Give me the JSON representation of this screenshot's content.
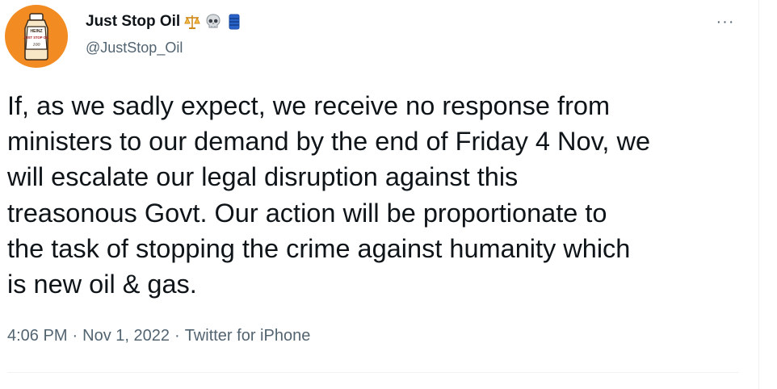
{
  "tweet": {
    "avatar": {
      "alt": "Just Stop Oil logo",
      "label_top": "HEINZ",
      "label_mid": "JUST STOP OIL",
      "label_num": "100",
      "color": "#f28c22"
    },
    "display_name": "Just Stop Oil",
    "name_emojis": [
      "balance-scale-icon",
      "skull-icon",
      "oil-barrel-icon"
    ],
    "handle": "@JustStop_Oil",
    "more_label": "···",
    "text": "If, as we sadly expect, we receive no response from\nministers to our demand by the end of Friday 4 Nov, we\nwill escalate our legal disruption against this\ntreasonous Govt. Our action will be proportionate to\nthe task of stopping the crime against humanity which\nis new oil & gas.",
    "time": "4:06 PM",
    "date": "Nov 1, 2022",
    "source": "Twitter for iPhone",
    "separator": "·"
  },
  "colors": {
    "text_primary": "#0f1419",
    "text_secondary": "#536471",
    "divider": "#eff3f4",
    "barrel": "#1d4fa8"
  }
}
